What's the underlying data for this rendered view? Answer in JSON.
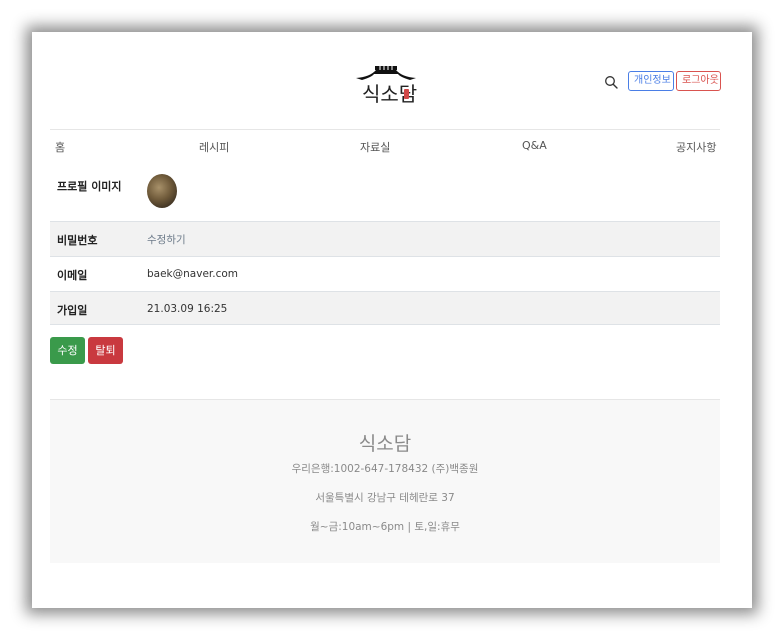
{
  "header": {
    "logo_text": "식소담",
    "privacy_button": "개인정보",
    "logout_button": "로그아웃"
  },
  "nav": {
    "items": [
      "홈",
      "레시피",
      "자료실",
      "Q&A",
      "공지사항"
    ]
  },
  "profile": {
    "rows": [
      {
        "label": "프로필 이미지",
        "value": ""
      },
      {
        "label": "비밀번호",
        "value": "수정하기"
      },
      {
        "label": "이메일",
        "value": "baek@naver.com"
      },
      {
        "label": "가입일",
        "value": "21.03.09 16:25"
      }
    ]
  },
  "actions": {
    "edit": "수정",
    "withdraw": "탈퇴"
  },
  "footer": {
    "title": "식소담",
    "bank": "우리은행:1002-647-178432 (주)백종원",
    "address": "서울특별시 강남구 테헤란로 37",
    "hours": "월~금:10am~6pm | 토,일:휴무"
  },
  "colors": {
    "primary_outline": "#4a7ee6",
    "danger": "#d9534f",
    "success": "#3a9a4b"
  }
}
